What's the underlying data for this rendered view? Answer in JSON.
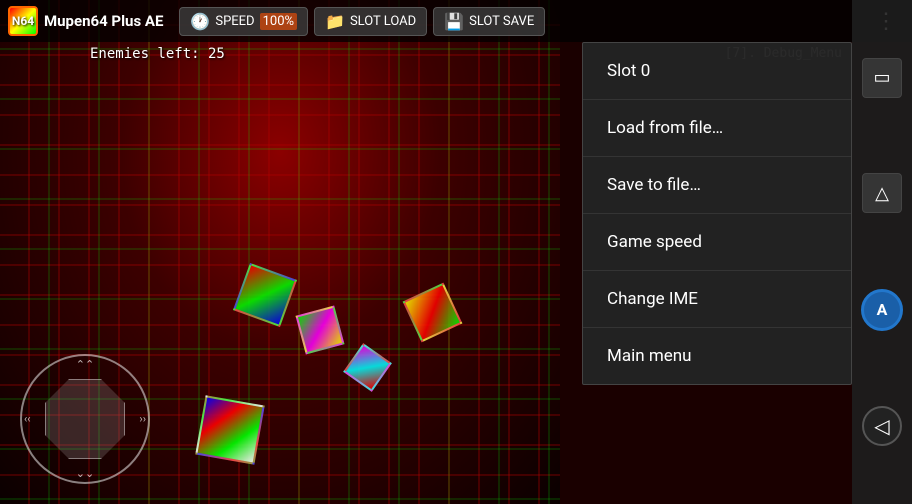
{
  "app": {
    "title": "Mupen64 Plus AE",
    "icon_label": "N64"
  },
  "topbar": {
    "speed_label": "SPEED",
    "speed_value": "100%",
    "slot_load_label": "SLOT LOAD",
    "slot_save_label": "SLOT SAVE",
    "more_icon": "⋮"
  },
  "hud": {
    "enemies_text": "Enemies left: 25",
    "top_right_text": "[7]. Debug_Menu"
  },
  "menu": {
    "items": [
      {
        "id": "slot0",
        "label": "Slot 0"
      },
      {
        "id": "load-file",
        "label": "Load from file…"
      },
      {
        "id": "save-file",
        "label": "Save to file…"
      },
      {
        "id": "game-speed",
        "label": "Game speed"
      },
      {
        "id": "change-ime",
        "label": "Change IME"
      },
      {
        "id": "main-menu",
        "label": "Main menu"
      }
    ]
  },
  "sys_buttons": {
    "recents_icon": "▭",
    "home_icon": "△",
    "back_icon": "◁",
    "a_label": "A"
  },
  "joystick": {
    "up_arrow": "⌃",
    "down_arrow": "⌄",
    "left_arrow": "‹",
    "right_arrow": "›"
  }
}
